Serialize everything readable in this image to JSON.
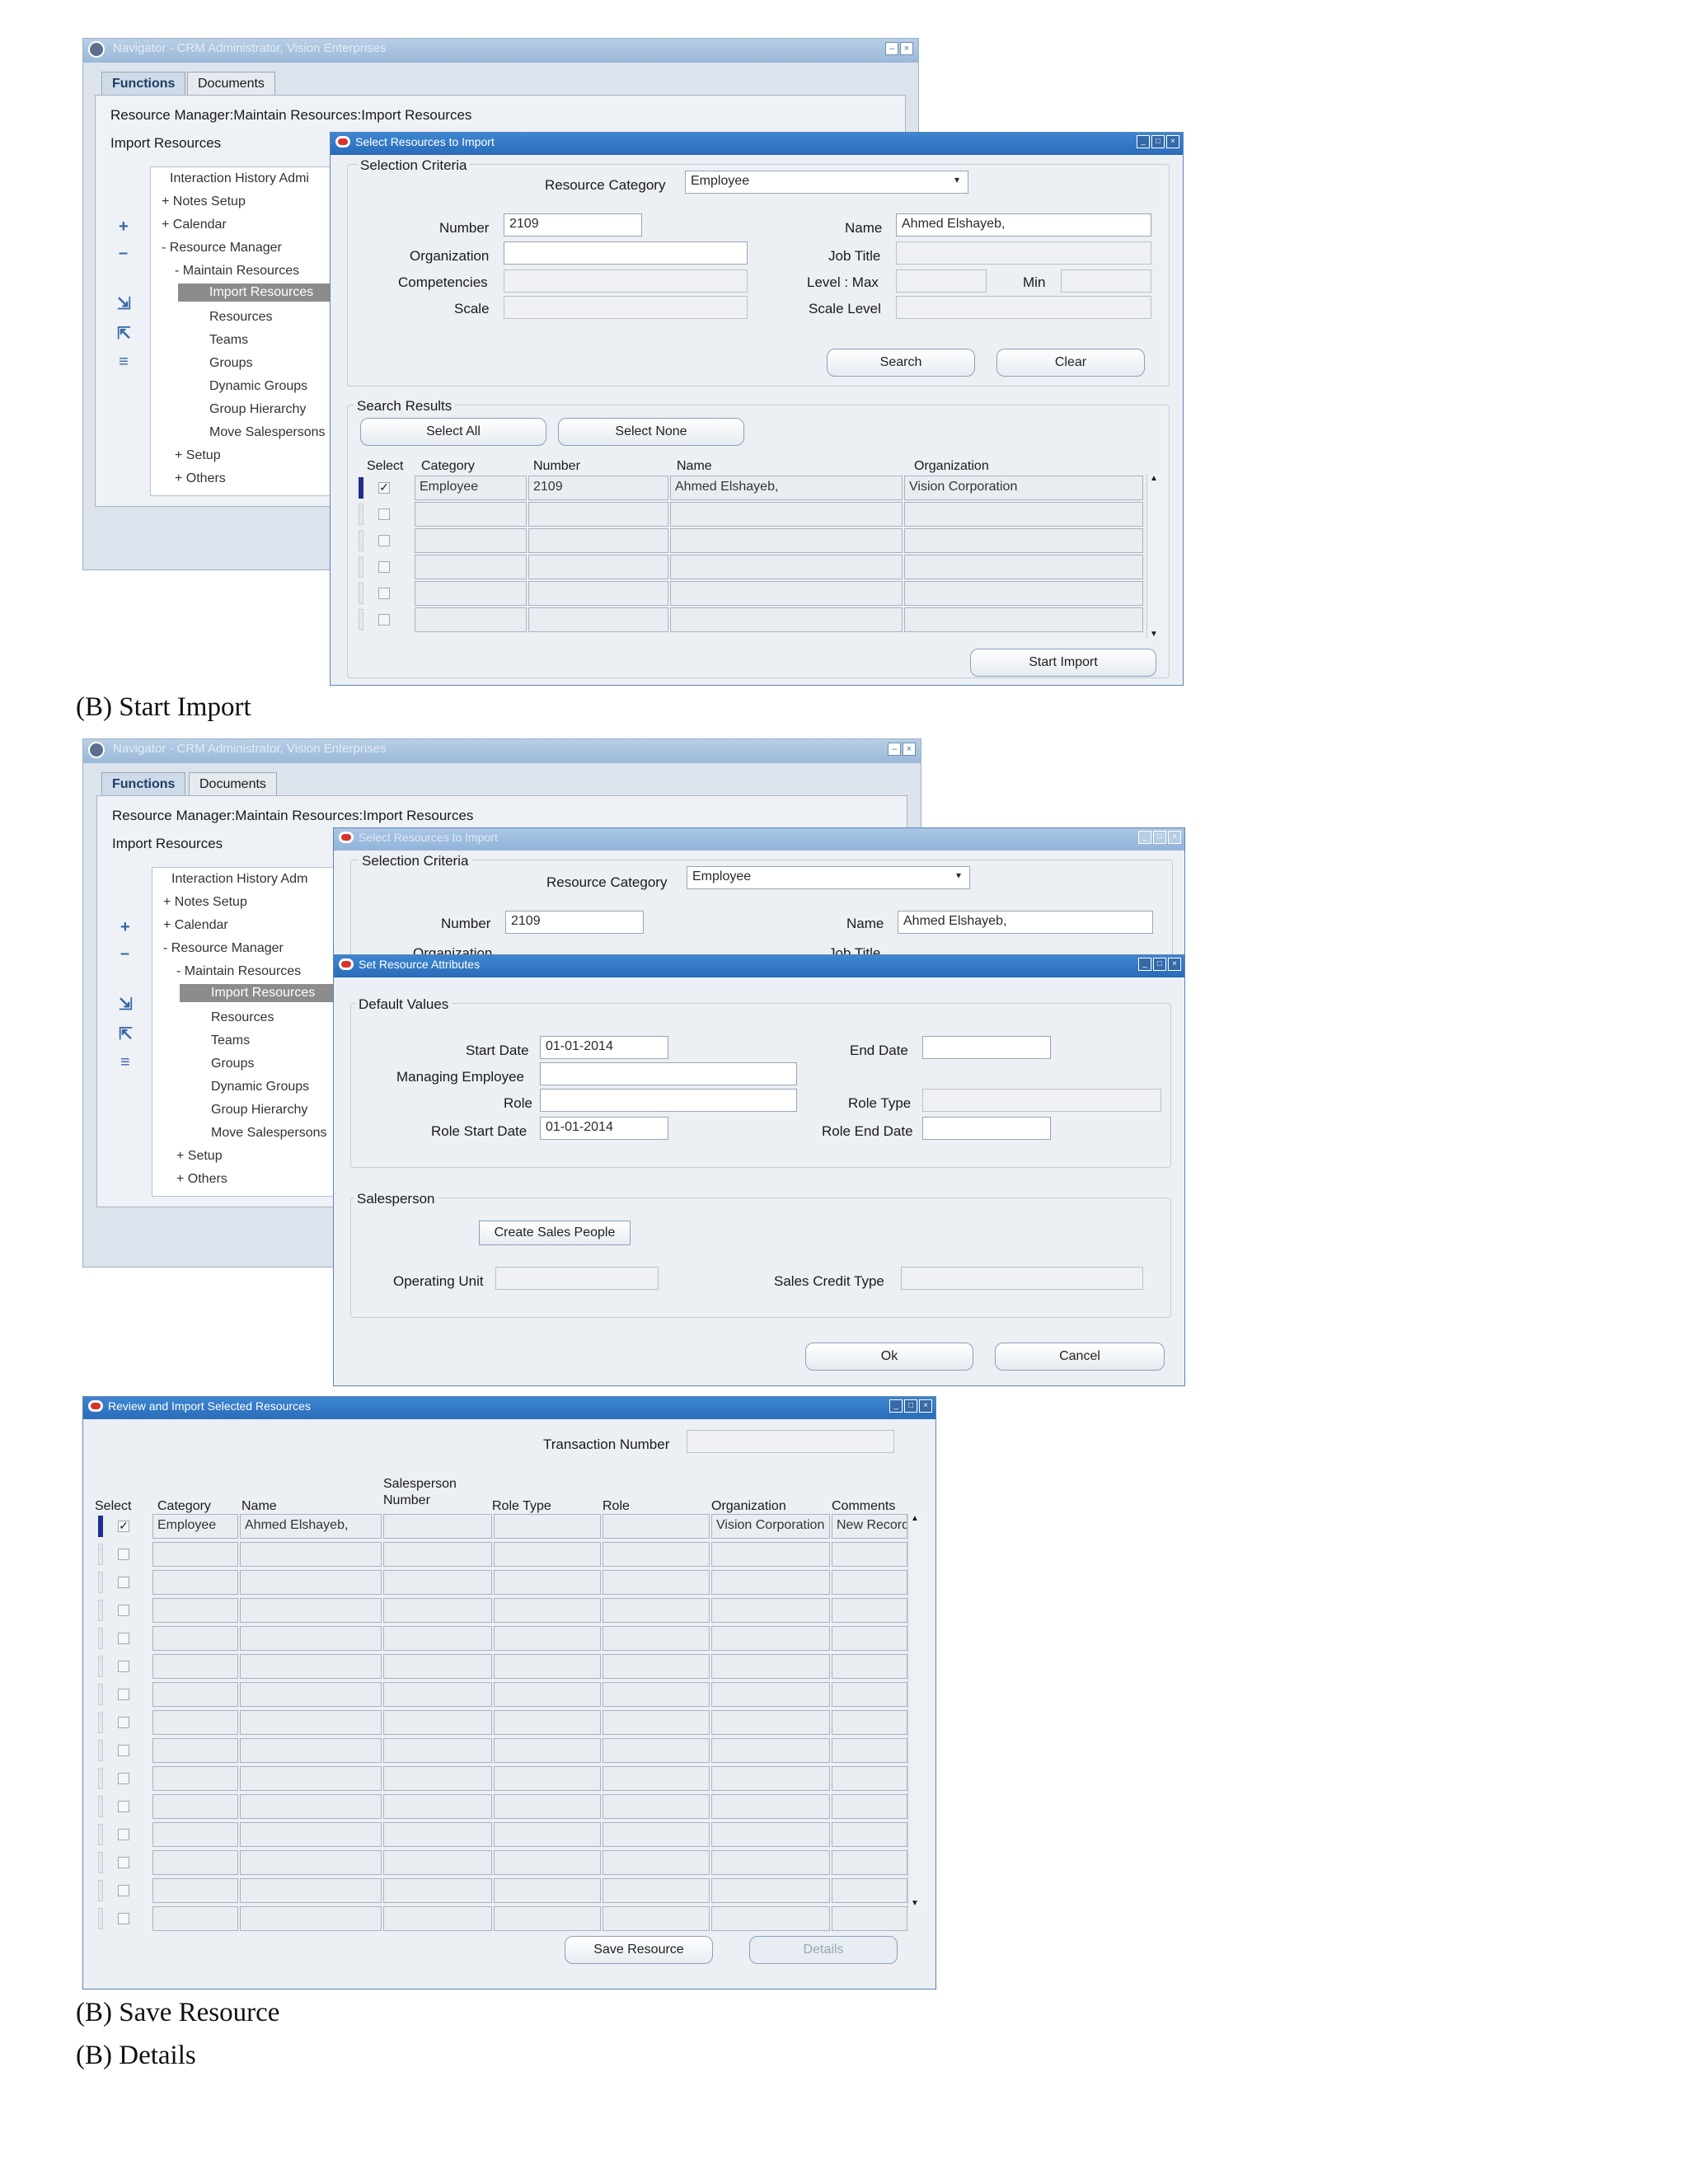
{
  "window1": {
    "shell_title": "Navigator - CRM Administrator, Vision Enterprises",
    "tabs": [
      "Functions",
      "Documents"
    ],
    "breadcrumb": "Resource Manager:Maintain Resources:Import Resources",
    "section_title": "Import Resources",
    "tree": [
      "Interaction History Admi",
      "+ Notes Setup",
      "+ Calendar",
      "- Resource Manager",
      "- Maintain Resources",
      "Import Resources",
      "Resources",
      "Teams",
      "Groups",
      "Dynamic Groups",
      "Group Hierarchy",
      "Move Salespersons",
      "+ Setup",
      "+ Others"
    ],
    "dialog": {
      "title": "Select Resources to Import",
      "selection_criteria": "Selection Criteria",
      "resource_category_label": "Resource Category",
      "resource_category_value": "Employee",
      "number_label": "Number",
      "number_value": "2109",
      "organization_label": "Organization",
      "competencies_label": "Competencies",
      "scale_label": "Scale",
      "name_label": "Name",
      "name_value": "Ahmed Elshayeb,",
      "job_title_label": "Job Title",
      "level_max_label": "Level : Max",
      "min_label": "Min",
      "scale_level_label": "Scale Level",
      "search_button": "Search",
      "clear_button": "Clear",
      "search_results": "Search Results",
      "select_all_button": "Select All",
      "select_none_button": "Select None",
      "columns": [
        "Select",
        "Category",
        "Number",
        "Name",
        "Organization"
      ],
      "rows": [
        {
          "checked": true,
          "category": "Employee",
          "number": "2109",
          "name": "Ahmed Elshayeb,",
          "organization": "Vision Corporation"
        },
        {
          "checked": false,
          "category": "",
          "number": "",
          "name": "",
          "organization": ""
        },
        {
          "checked": false,
          "category": "",
          "number": "",
          "name": "",
          "organization": ""
        },
        {
          "checked": false,
          "category": "",
          "number": "",
          "name": "",
          "organization": ""
        },
        {
          "checked": false,
          "category": "",
          "number": "",
          "name": "",
          "organization": ""
        },
        {
          "checked": false,
          "category": "",
          "number": "",
          "name": "",
          "organization": ""
        }
      ],
      "start_import_button": "Start Import"
    }
  },
  "caption1": "(B) Start Import",
  "window2": {
    "shell_title": "Navigator - CRM Administrator, Vision Enterprises",
    "tabs": [
      "Functions",
      "Documents"
    ],
    "breadcrumb": "Resource Manager:Maintain Resources:Import Resources",
    "section_title": "Import Resources",
    "tree": [
      "Interaction History Adm",
      "+ Notes Setup",
      "+ Calendar",
      "- Resource Manager",
      "- Maintain Resources",
      "Import Resources",
      "Resources",
      "Teams",
      "Groups",
      "Dynamic Groups",
      "Group Hierarchy",
      "Move Salespersons",
      "+ Setup",
      "+ Others"
    ],
    "back_dialog": {
      "title": "Select Resources to Import",
      "selection_criteria": "Selection Criteria",
      "resource_category_label": "Resource Category",
      "resource_category_value": "Employee",
      "number_label": "Number",
      "number_value": "2109",
      "name_label": "Name",
      "name_value": "Ahmed Elshayeb,",
      "organization_partial": "Organization",
      "job_title_partial": "Job Title"
    },
    "dialog": {
      "title": "Set Resource Attributes",
      "default_values": "Default Values",
      "start_date_label": "Start Date",
      "start_date_value": "01-01-2014",
      "managing_employee_label": "Managing Employee",
      "role_label": "Role",
      "role_start_date_label": "Role Start Date",
      "role_start_date_value": "01-01-2014",
      "end_date_label": "End Date",
      "role_type_label": "Role Type",
      "role_end_date_label": "Role End Date",
      "salesperson_label": "Salesperson",
      "create_sales_people_button": "Create Sales People",
      "operating_unit_label": "Operating Unit",
      "sales_credit_type_label": "Sales Credit Type",
      "ok_button": "Ok",
      "cancel_button": "Cancel"
    }
  },
  "window3": {
    "title": "Review and Import Selected Resources",
    "transaction_number_label": "Transaction Number",
    "columns": [
      "Select",
      "Category",
      "Name",
      "Salesperson Number",
      "Role Type",
      "Role",
      "Organization",
      "Comments"
    ],
    "rows": [
      {
        "checked": true,
        "category": "Employee",
        "name": "Ahmed Elshayeb,",
        "salesperson_number": "",
        "role_type": "",
        "role": "",
        "organization": "Vision Corporation",
        "comments": "New Record"
      }
    ],
    "empty_rows": 14,
    "save_resource_button": "Save Resource",
    "details_button": "Details"
  },
  "caption2": "(B) Save Resource",
  "caption3": "(B) Details"
}
